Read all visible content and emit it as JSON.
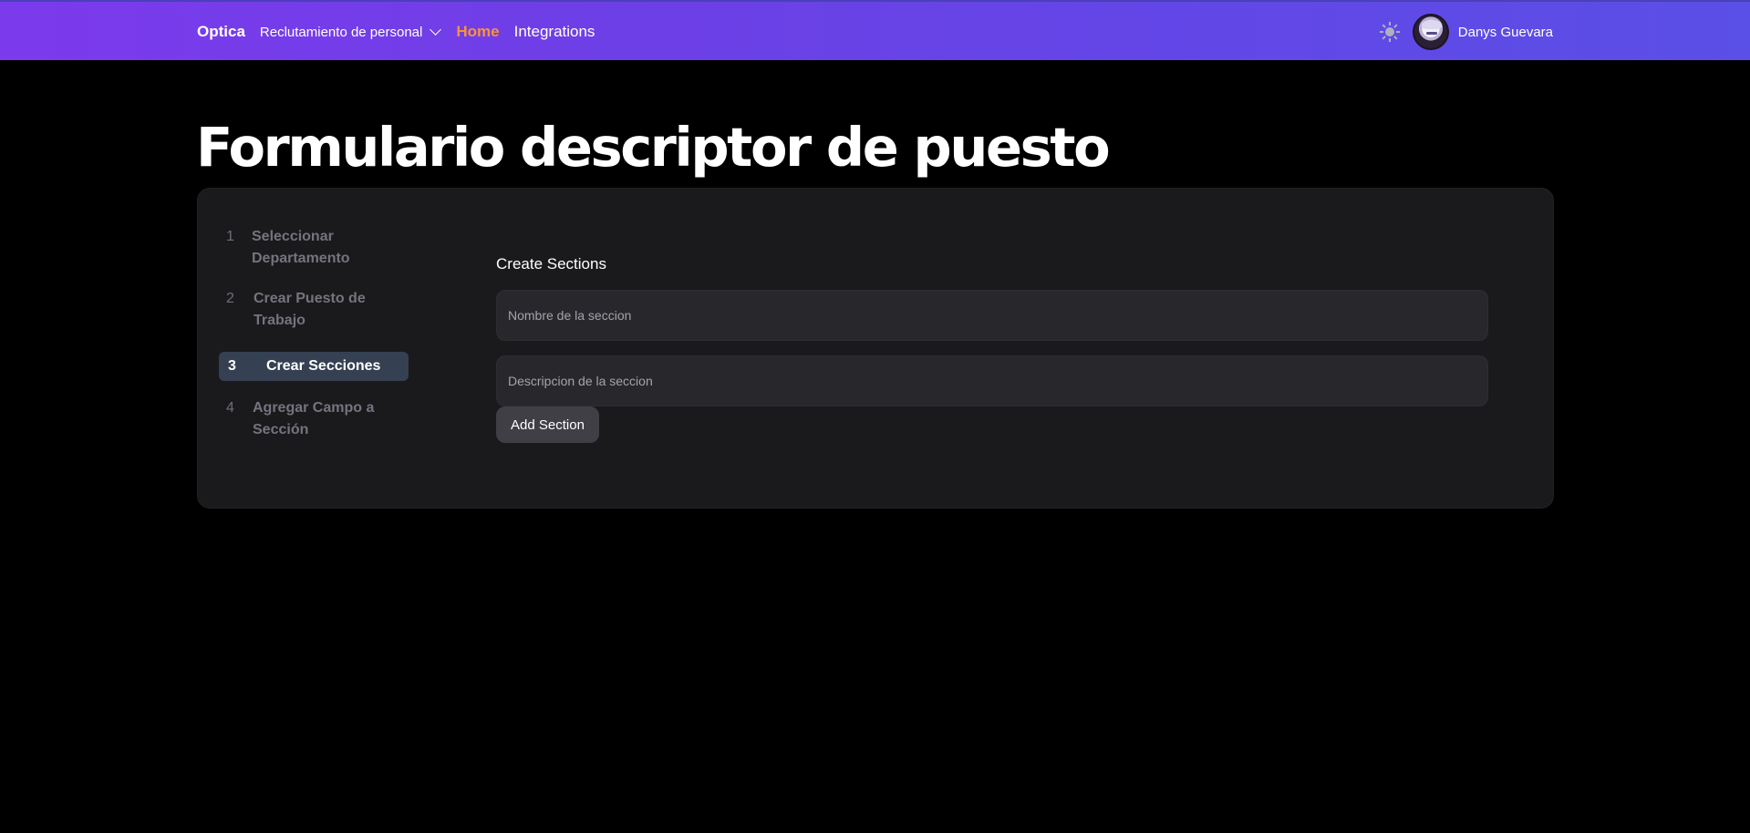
{
  "navbar": {
    "brand": "Optica",
    "dropdown_label": "Reclutamiento de personal",
    "links": [
      {
        "label": "Home",
        "active": true
      },
      {
        "label": "Integrations",
        "active": false
      }
    ],
    "theme_icon": "sun-icon",
    "user": {
      "name": "Danys Guevara",
      "avatar_icon": "avatar"
    }
  },
  "page": {
    "title": "Formulario descriptor de puesto"
  },
  "stepper": {
    "steps": [
      {
        "number": "1",
        "label": "Seleccionar Departamento",
        "active": false
      },
      {
        "number": "2",
        "label": "Crear Puesto de Trabajo",
        "active": false
      },
      {
        "number": "3",
        "label": "Crear Secciones",
        "active": true
      },
      {
        "number": "4",
        "label": "Agregar Campo a Sección",
        "active": false
      }
    ]
  },
  "form": {
    "heading": "Create Sections",
    "name_field": {
      "placeholder": "Nombre de la seccion",
      "value": ""
    },
    "description_field": {
      "placeholder": "Descripcion de la seccion",
      "value": ""
    },
    "submit_label": "Add Section"
  },
  "colors": {
    "active_link": "#fb923c",
    "active_step_bg": "#354052",
    "card_bg": "#1a1a1d",
    "navbar_gradient_start": "#7c3aed",
    "navbar_gradient_end": "#5a4fe6"
  }
}
